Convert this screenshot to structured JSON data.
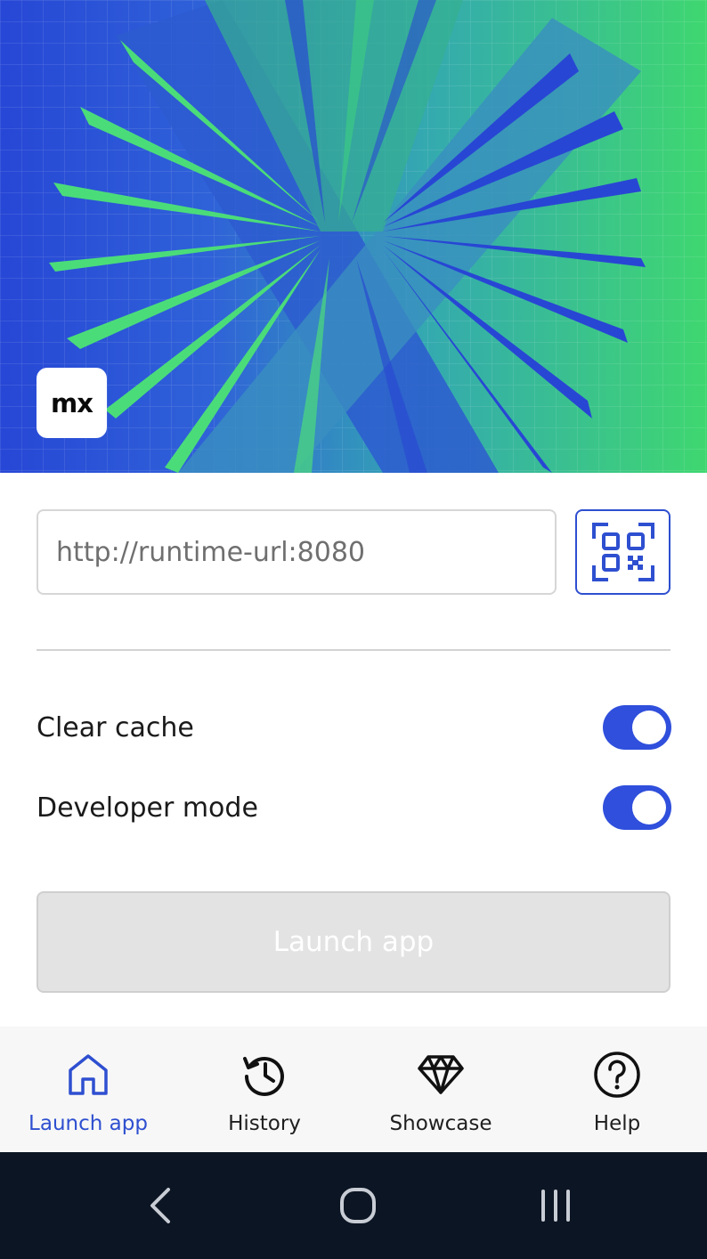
{
  "brand": {
    "logo_text": "mx",
    "accent_color": "#2e4fd0",
    "hero_gradient": [
      "#2747d6",
      "#3fd770"
    ]
  },
  "connect": {
    "url_placeholder": "http://runtime-url:8080",
    "url_value": "",
    "scan_icon": "qr-code-scan-icon"
  },
  "settings": {
    "clear_cache": {
      "label": "Clear cache",
      "enabled": true
    },
    "developer_mode": {
      "label": "Developer mode",
      "enabled": true
    }
  },
  "launch_button": {
    "label": "Launch app",
    "disabled": true
  },
  "tabs": [
    {
      "label": "Launch app",
      "icon": "home-icon",
      "active": true
    },
    {
      "label": "History",
      "icon": "history-icon",
      "active": false
    },
    {
      "label": "Showcase",
      "icon": "diamond-icon",
      "active": false
    },
    {
      "label": "Help",
      "icon": "help-icon",
      "active": false
    }
  ],
  "system_nav": {
    "back_icon": "back-icon",
    "home_icon": "home-circle-icon",
    "recents_icon": "recent-apps-icon"
  }
}
